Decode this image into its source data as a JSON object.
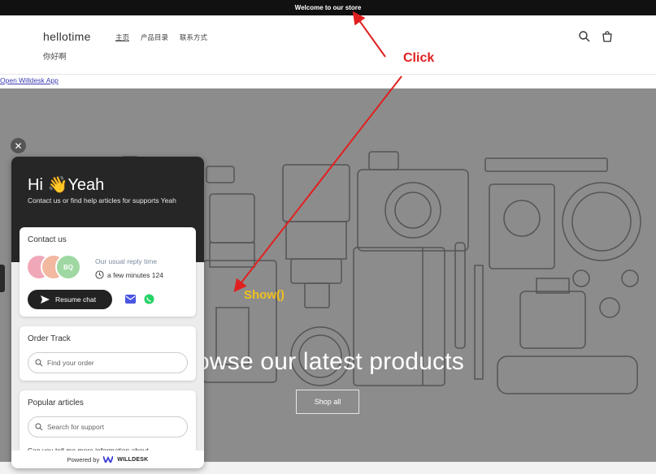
{
  "announcement": "Welcome to our store",
  "header": {
    "logo": "hellotime",
    "subtitle": "你好啊",
    "nav": [
      {
        "label": "主页",
        "active": true
      },
      {
        "label": "产品目录",
        "active": false
      },
      {
        "label": "联系方式",
        "active": false
      }
    ],
    "icons": [
      "search-icon",
      "cart-icon"
    ]
  },
  "open_app_link": "Open Willdesk App",
  "hero": {
    "title": "owse our latest products",
    "button": "Shop all"
  },
  "annotations": {
    "click": "Click",
    "show": "Show()"
  },
  "widget": {
    "greeting": "Hi 👋Yeah",
    "description": "Contact us or find help articles for supports Yeah",
    "contact": {
      "title": "Contact us",
      "avatar_initials": "BQ",
      "reply_label": "Our usual reply time",
      "reply_value": "a few minutes 124",
      "resume_button": "Resume chat"
    },
    "order": {
      "title": "Order Track",
      "placeholder": "Find your order"
    },
    "articles": {
      "title": "Popular articles",
      "placeholder": "Search for support",
      "first_item": "Can you tell me more information about"
    },
    "powered_by": "Powered by",
    "brand": "WILLDESK"
  },
  "colors": {
    "announcement_bg": "#111111",
    "hero_bg": "#8c8c8c",
    "widget_head": "#262626",
    "click_annotation": "#e02020",
    "show_annotation": "#f0c020",
    "whatsapp": "#25d366",
    "mail": "#4a56e2"
  }
}
